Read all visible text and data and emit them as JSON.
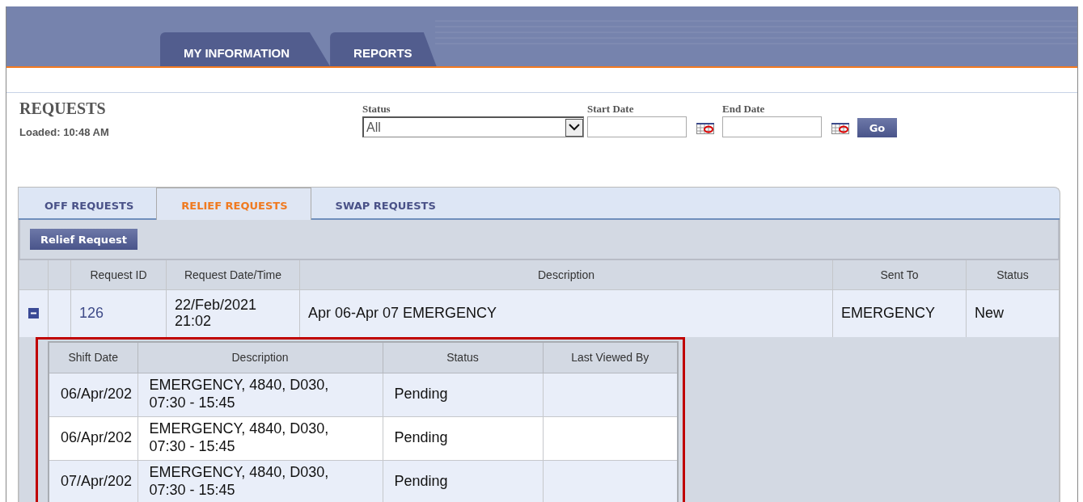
{
  "main_tabs": [
    {
      "label": "MY INFORMATION"
    },
    {
      "label": "REPORTS"
    }
  ],
  "page": {
    "title": "REQUESTS",
    "loaded": "Loaded: 10:48 AM"
  },
  "filters": {
    "status": {
      "label": "Status",
      "value": "All"
    },
    "start_date": {
      "label": "Start Date"
    },
    "end_date": {
      "label": "End Date"
    },
    "go": "Go"
  },
  "sub_tabs": [
    {
      "label": "OFF REQUESTS",
      "selected": false
    },
    {
      "label": "RELIEF REQUESTS",
      "selected": true
    },
    {
      "label": "SWAP REQUESTS",
      "selected": false
    }
  ],
  "toolbar": {
    "button": "Relief Request"
  },
  "table": {
    "columns": [
      "Request ID",
      "Request Date/Time",
      "Description",
      "Sent To",
      "Status"
    ],
    "rows": [
      {
        "expanded": true,
        "request_id": "126",
        "date": "22/Feb/2021",
        "time": "21:02",
        "description": "Apr 06-Apr 07 EMERGENCY",
        "sent_to": "EMERGENCY",
        "status": "New",
        "details": {
          "columns": [
            "Shift Date",
            "Description",
            "Status",
            "Last Viewed By"
          ],
          "rows": [
            {
              "shift_date": "06/Apr/202",
              "description": "EMERGENCY, 4840, D030, 07:30 - 15:45",
              "status": "Pending"
            },
            {
              "shift_date": "06/Apr/202",
              "description": "EMERGENCY, 4840, D030, 07:30 - 15:45",
              "status": "Pending"
            },
            {
              "shift_date": "07/Apr/202",
              "description": "EMERGENCY, 4840, D030, 07:30 - 15:45",
              "status": "Pending"
            }
          ]
        }
      }
    ]
  }
}
